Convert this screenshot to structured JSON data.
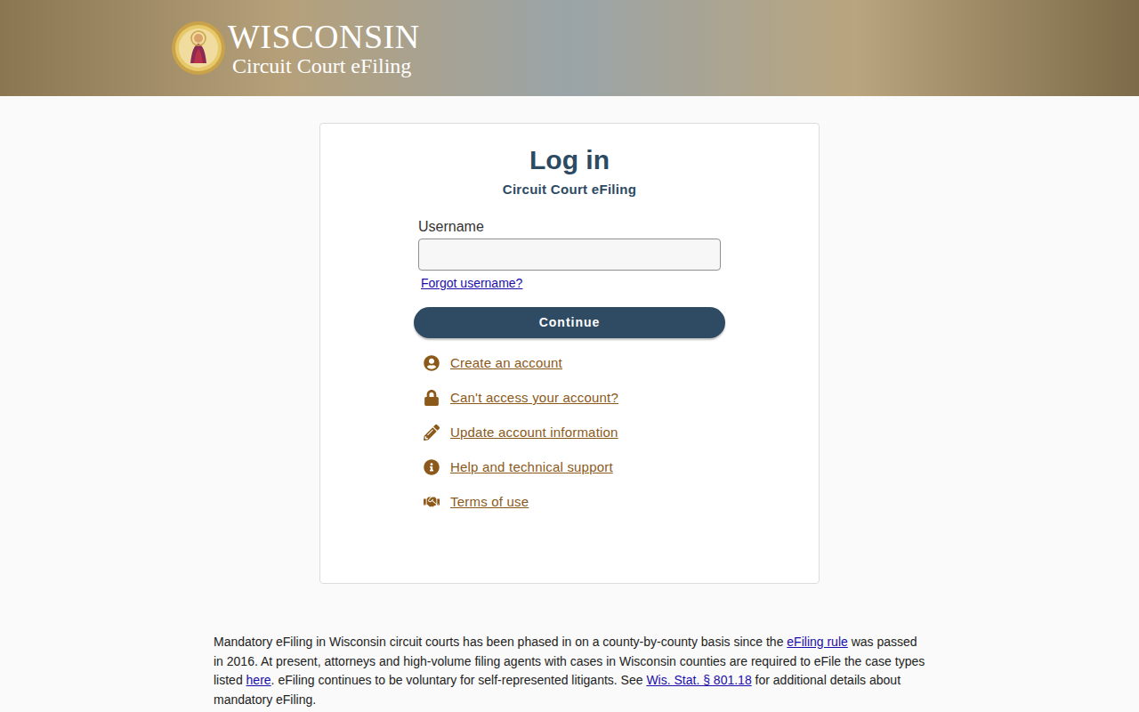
{
  "header": {
    "title": "WISCONSIN",
    "subtitle": "Circuit Court eFiling"
  },
  "login": {
    "heading": "Log in",
    "subheading": "Circuit Court eFiling",
    "username_label": "Username",
    "username_value": "",
    "forgot_link": "Forgot username?",
    "continue_button": "Continue"
  },
  "links": [
    {
      "label": "Create an account"
    },
    {
      "label": "Can't access your account?"
    },
    {
      "label": "Update account information"
    },
    {
      "label": "Help and technical support"
    },
    {
      "label": "Terms of use"
    }
  ],
  "notice": [
    {
      "kind": "text",
      "text": "Mandatory eFiling in Wisconsin circuit courts has been phased in on a county-by-county basis since the "
    },
    {
      "kind": "link",
      "text": "eFiling rule"
    },
    {
      "kind": "text",
      "text": " was passed in 2016. At present, attorneys and high-volume filing agents with cases in Wisconsin counties are required to eFile the case types listed "
    },
    {
      "kind": "link",
      "text": "here"
    },
    {
      "kind": "text",
      "text": ". eFiling continues to be voluntary for self-represented litigants. See "
    },
    {
      "kind": "link",
      "text": "Wis. Stat. § 801.18"
    },
    {
      "kind": "text",
      "text": " for additional details about mandatory eFiling."
    }
  ]
}
